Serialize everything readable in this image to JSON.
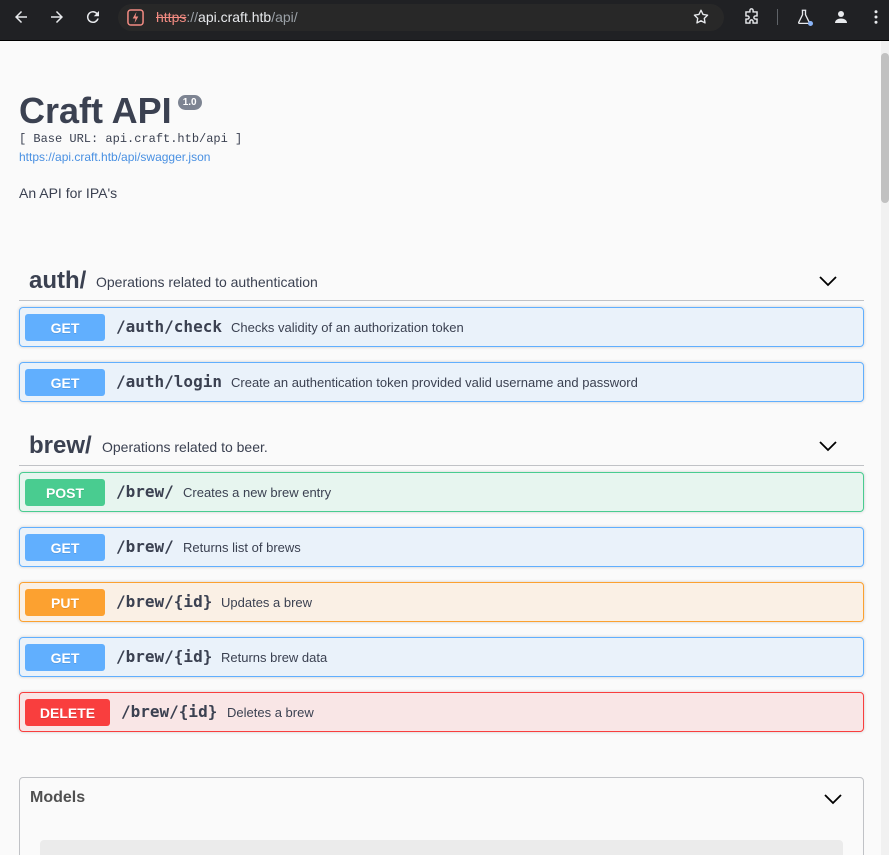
{
  "browser": {
    "url_scheme": "https",
    "url_sep": "://",
    "url_host": "api.craft.htb",
    "url_path": "/api/"
  },
  "api": {
    "title": "Craft API",
    "version": "1.0",
    "base_url": "[ Base URL: api.craft.htb/api ]",
    "spec_link": "https://api.craft.htb/api/swagger.json",
    "description": "An API for IPA's"
  },
  "tags": [
    {
      "name": "auth/",
      "description": "Operations related to authentication",
      "operations": [
        {
          "method": "GET",
          "path": "/auth/check",
          "summary": "Checks validity of an authorization token"
        },
        {
          "method": "GET",
          "path": "/auth/login",
          "summary": "Create an authentication token provided valid username and password"
        }
      ]
    },
    {
      "name": "brew/",
      "description": "Operations related to beer.",
      "operations": [
        {
          "method": "POST",
          "path": "/brew/",
          "summary": "Creates a new brew entry"
        },
        {
          "method": "GET",
          "path": "/brew/",
          "summary": "Returns list of brews"
        },
        {
          "method": "PUT",
          "path": "/brew/{id}",
          "summary": "Updates a brew"
        },
        {
          "method": "GET",
          "path": "/brew/{id}",
          "summary": "Returns brew data"
        },
        {
          "method": "DELETE",
          "path": "/brew/{id}",
          "summary": "Deletes a brew"
        }
      ]
    }
  ],
  "models": {
    "title": "Models"
  },
  "colors": {
    "get": "#61affe",
    "post": "#49cc90",
    "put": "#fca130",
    "delete": "#f93e3e"
  }
}
